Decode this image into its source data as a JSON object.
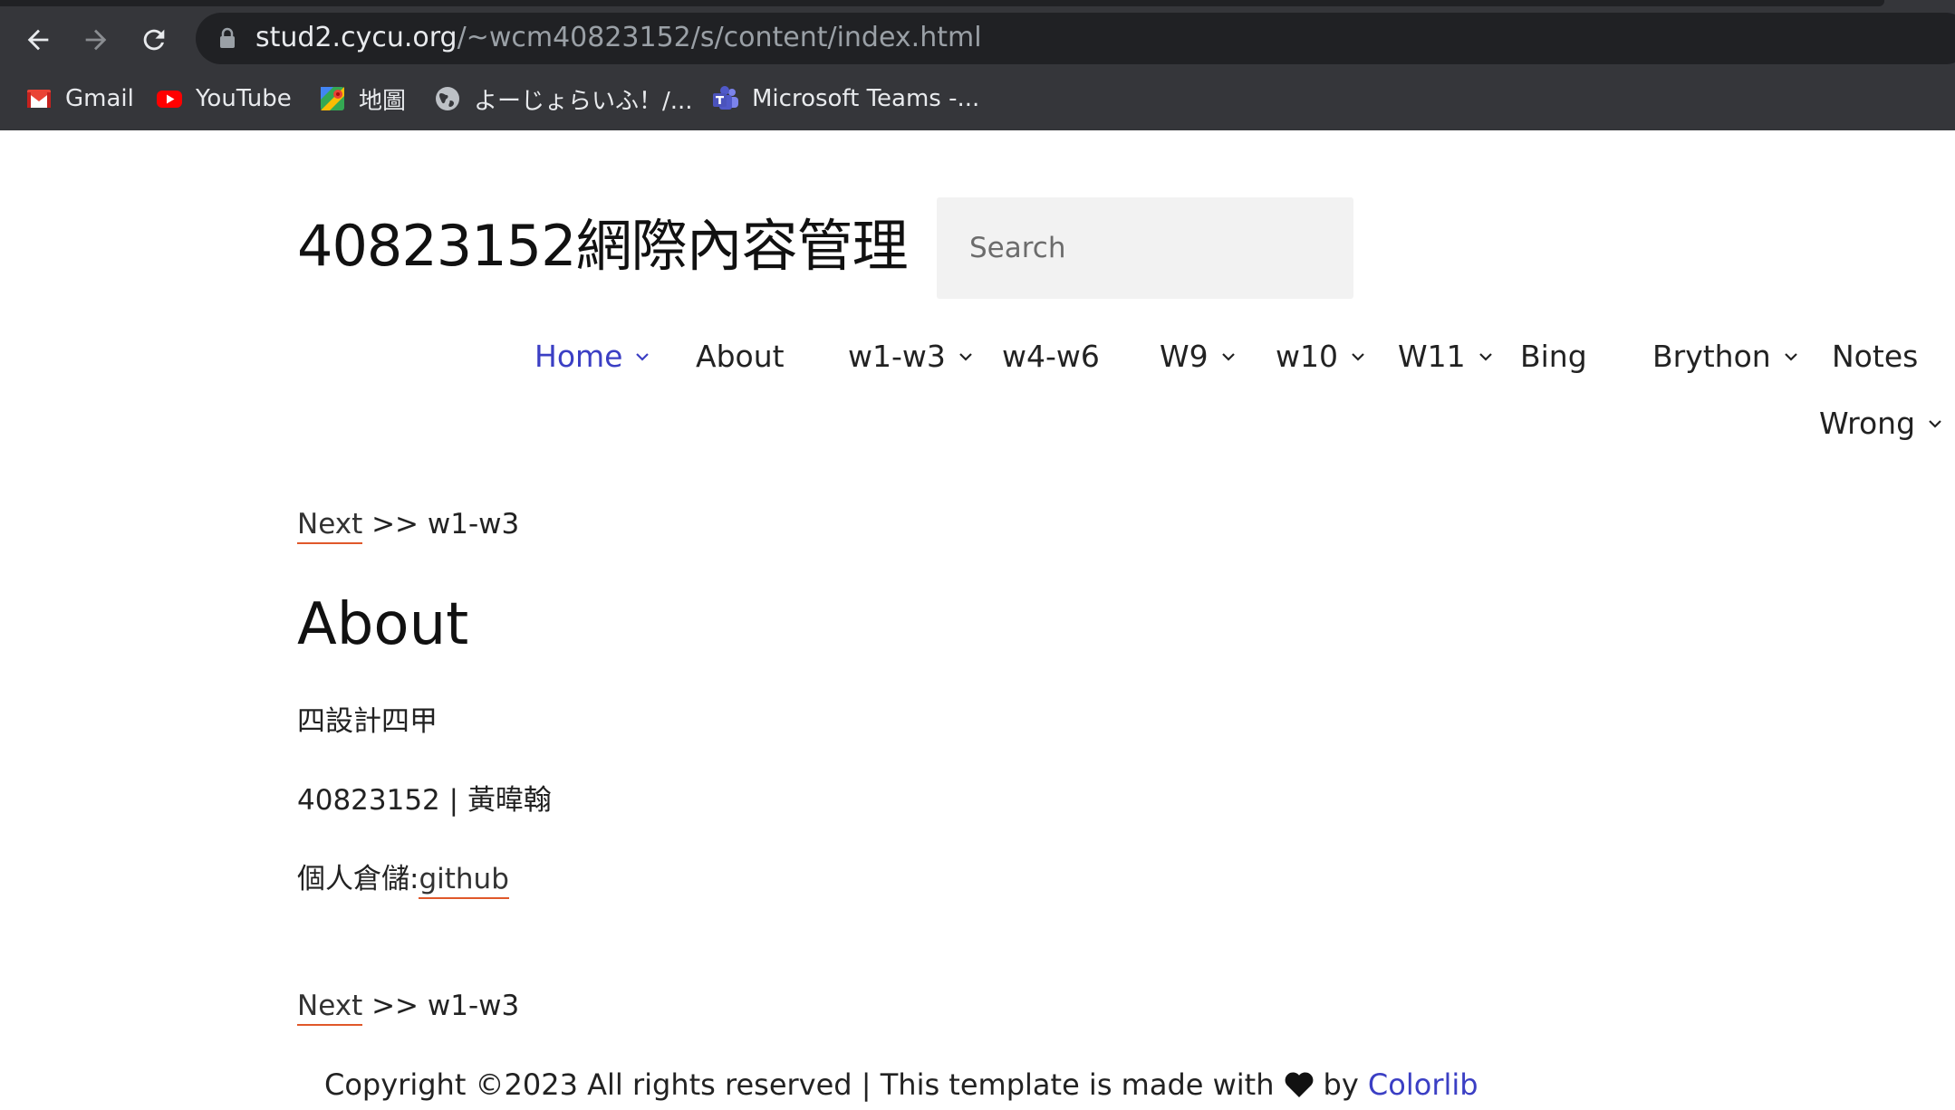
{
  "browser": {
    "url_host": "stud2.cycu.org",
    "url_path": "/~wcm40823152/s/content/index.html",
    "bookmarks": [
      {
        "label": "Gmail",
        "icon": "gmail-icon"
      },
      {
        "label": "YouTube",
        "icon": "youtube-icon"
      },
      {
        "label": "地圖",
        "icon": "maps-icon"
      },
      {
        "label": "よーじょらいふ！/...",
        "icon": "globe-icon"
      },
      {
        "label": "Microsoft Teams -...",
        "icon": "teams-icon"
      }
    ]
  },
  "site": {
    "title": "40823152網際內容管理",
    "search_placeholder": "Search"
  },
  "menu": {
    "items": [
      {
        "label": "Home",
        "has_dropdown": true,
        "active": true
      },
      {
        "label": "About",
        "has_dropdown": false
      },
      {
        "label": "w1-w3",
        "has_dropdown": true
      },
      {
        "label": "w4-w6",
        "has_dropdown": false
      },
      {
        "label": "W9",
        "has_dropdown": true
      },
      {
        "label": "w10",
        "has_dropdown": true
      },
      {
        "label": "W11",
        "has_dropdown": true
      },
      {
        "label": "Bing",
        "has_dropdown": false
      },
      {
        "label": "Brython",
        "has_dropdown": true
      },
      {
        "label": "Notes",
        "has_dropdown": false
      },
      {
        "label": "Wrong",
        "has_dropdown": true
      }
    ]
  },
  "content": {
    "nav_top": {
      "next_label": "Next",
      "separator": " >> ",
      "target": "w1-w3"
    },
    "heading": "About",
    "line1": "四設計四甲",
    "line2": "40823152 | 黃暐翰",
    "line3_prefix": "個人倉儲:",
    "line3_link": "github",
    "nav_bottom": {
      "next_label": "Next",
      "separator": " >> ",
      "target": "w1-w3"
    }
  },
  "footer": {
    "text_before": "Copyright ©2023 All rights reserved | This template is made with",
    "text_by": "by",
    "link": "Colorlib"
  },
  "colors": {
    "chrome_bg": "#35363a",
    "omnibox_bg": "#202124",
    "accent_link": "#3b3fc4",
    "underline": "#e0582a"
  }
}
